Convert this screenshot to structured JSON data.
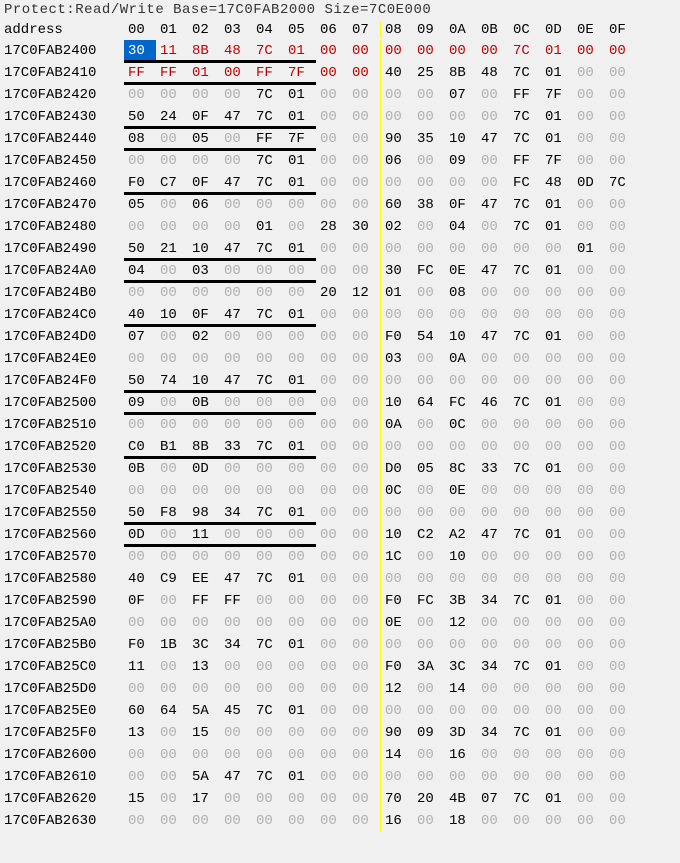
{
  "title_line": "Protect:Read/Write  Base=17C0FAB2000 Size=7C0E000",
  "header": {
    "address_label": "address",
    "cols": [
      "00",
      "01",
      "02",
      "03",
      "04",
      "05",
      "06",
      "07",
      "08",
      "09",
      "0A",
      "0B",
      "0C",
      "0D",
      "0E",
      "0F"
    ]
  },
  "selected": {
    "row": 0,
    "col": 0
  },
  "red_cells": [
    {
      "row": 0,
      "start": 0,
      "end": 7
    },
    {
      "row": 0,
      "start": 8,
      "end": 15
    },
    {
      "row": 1,
      "start": 0,
      "end": 7
    }
  ],
  "underlines": [
    {
      "row": 0,
      "cols": 6
    },
    {
      "row": 1,
      "cols": 6
    },
    {
      "row": 3,
      "cols": 6
    },
    {
      "row": 4,
      "cols": 6
    },
    {
      "row": 6,
      "cols": 6
    },
    {
      "row": 9,
      "cols": 6
    },
    {
      "row": 10,
      "cols": 6
    },
    {
      "row": 12,
      "cols": 6
    },
    {
      "row": 15,
      "cols": 6
    },
    {
      "row": 16,
      "cols": 6
    },
    {
      "row": 18,
      "cols": 6
    },
    {
      "row": 21,
      "cols": 6
    },
    {
      "row": 22,
      "cols": 6
    }
  ],
  "rows": [
    {
      "addr": "17C0FAB2400",
      "b": [
        "30",
        "11",
        "8B",
        "48",
        "7C",
        "01",
        "00",
        "00",
        "00",
        "00",
        "00",
        "00",
        "7C",
        "01",
        "00",
        "00"
      ]
    },
    {
      "addr": "17C0FAB2410",
      "b": [
        "FF",
        "FF",
        "01",
        "00",
        "FF",
        "7F",
        "00",
        "00",
        "40",
        "25",
        "8B",
        "48",
        "7C",
        "01",
        "00",
        "00"
      ]
    },
    {
      "addr": "17C0FAB2420",
      "b": [
        "00",
        "00",
        "00",
        "00",
        "7C",
        "01",
        "00",
        "00",
        "00",
        "00",
        "07",
        "00",
        "FF",
        "7F",
        "00",
        "00"
      ]
    },
    {
      "addr": "17C0FAB2430",
      "b": [
        "50",
        "24",
        "0F",
        "47",
        "7C",
        "01",
        "00",
        "00",
        "00",
        "00",
        "00",
        "00",
        "7C",
        "01",
        "00",
        "00"
      ]
    },
    {
      "addr": "17C0FAB2440",
      "b": [
        "08",
        "00",
        "05",
        "00",
        "FF",
        "7F",
        "00",
        "00",
        "90",
        "35",
        "10",
        "47",
        "7C",
        "01",
        "00",
        "00"
      ]
    },
    {
      "addr": "17C0FAB2450",
      "b": [
        "00",
        "00",
        "00",
        "00",
        "7C",
        "01",
        "00",
        "00",
        "06",
        "00",
        "09",
        "00",
        "FF",
        "7F",
        "00",
        "00"
      ]
    },
    {
      "addr": "17C0FAB2460",
      "b": [
        "F0",
        "C7",
        "0F",
        "47",
        "7C",
        "01",
        "00",
        "00",
        "00",
        "00",
        "00",
        "00",
        "FC",
        "48",
        "0D",
        "7C"
      ]
    },
    {
      "addr": "17C0FAB2470",
      "b": [
        "05",
        "00",
        "06",
        "00",
        "00",
        "00",
        "00",
        "00",
        "60",
        "38",
        "0F",
        "47",
        "7C",
        "01",
        "00",
        "00"
      ]
    },
    {
      "addr": "17C0FAB2480",
      "b": [
        "00",
        "00",
        "00",
        "00",
        "01",
        "00",
        "28",
        "30",
        "02",
        "00",
        "04",
        "00",
        "7C",
        "01",
        "00",
        "00"
      ]
    },
    {
      "addr": "17C0FAB2490",
      "b": [
        "50",
        "21",
        "10",
        "47",
        "7C",
        "01",
        "00",
        "00",
        "00",
        "00",
        "00",
        "00",
        "00",
        "00",
        "01",
        "00"
      ]
    },
    {
      "addr": "17C0FAB24A0",
      "b": [
        "04",
        "00",
        "03",
        "00",
        "00",
        "00",
        "00",
        "00",
        "30",
        "FC",
        "0E",
        "47",
        "7C",
        "01",
        "00",
        "00"
      ]
    },
    {
      "addr": "17C0FAB24B0",
      "b": [
        "00",
        "00",
        "00",
        "00",
        "00",
        "00",
        "20",
        "12",
        "01",
        "00",
        "08",
        "00",
        "00",
        "00",
        "00",
        "00"
      ]
    },
    {
      "addr": "17C0FAB24C0",
      "b": [
        "40",
        "10",
        "0F",
        "47",
        "7C",
        "01",
        "00",
        "00",
        "00",
        "00",
        "00",
        "00",
        "00",
        "00",
        "00",
        "00"
      ]
    },
    {
      "addr": "17C0FAB24D0",
      "b": [
        "07",
        "00",
        "02",
        "00",
        "00",
        "00",
        "00",
        "00",
        "F0",
        "54",
        "10",
        "47",
        "7C",
        "01",
        "00",
        "00"
      ]
    },
    {
      "addr": "17C0FAB24E0",
      "b": [
        "00",
        "00",
        "00",
        "00",
        "00",
        "00",
        "00",
        "00",
        "03",
        "00",
        "0A",
        "00",
        "00",
        "00",
        "00",
        "00"
      ]
    },
    {
      "addr": "17C0FAB24F0",
      "b": [
        "50",
        "74",
        "10",
        "47",
        "7C",
        "01",
        "00",
        "00",
        "00",
        "00",
        "00",
        "00",
        "00",
        "00",
        "00",
        "00"
      ]
    },
    {
      "addr": "17C0FAB2500",
      "b": [
        "09",
        "00",
        "0B",
        "00",
        "00",
        "00",
        "00",
        "00",
        "10",
        "64",
        "FC",
        "46",
        "7C",
        "01",
        "00",
        "00"
      ]
    },
    {
      "addr": "17C0FAB2510",
      "b": [
        "00",
        "00",
        "00",
        "00",
        "00",
        "00",
        "00",
        "00",
        "0A",
        "00",
        "0C",
        "00",
        "00",
        "00",
        "00",
        "00"
      ]
    },
    {
      "addr": "17C0FAB2520",
      "b": [
        "C0",
        "B1",
        "8B",
        "33",
        "7C",
        "01",
        "00",
        "00",
        "00",
        "00",
        "00",
        "00",
        "00",
        "00",
        "00",
        "00"
      ]
    },
    {
      "addr": "17C0FAB2530",
      "b": [
        "0B",
        "00",
        "0D",
        "00",
        "00",
        "00",
        "00",
        "00",
        "D0",
        "05",
        "8C",
        "33",
        "7C",
        "01",
        "00",
        "00"
      ]
    },
    {
      "addr": "17C0FAB2540",
      "b": [
        "00",
        "00",
        "00",
        "00",
        "00",
        "00",
        "00",
        "00",
        "0C",
        "00",
        "0E",
        "00",
        "00",
        "00",
        "00",
        "00"
      ]
    },
    {
      "addr": "17C0FAB2550",
      "b": [
        "50",
        "F8",
        "98",
        "34",
        "7C",
        "01",
        "00",
        "00",
        "00",
        "00",
        "00",
        "00",
        "00",
        "00",
        "00",
        "00"
      ]
    },
    {
      "addr": "17C0FAB2560",
      "b": [
        "0D",
        "00",
        "11",
        "00",
        "00",
        "00",
        "00",
        "00",
        "10",
        "C2",
        "A2",
        "47",
        "7C",
        "01",
        "00",
        "00"
      ]
    },
    {
      "addr": "17C0FAB2570",
      "b": [
        "00",
        "00",
        "00",
        "00",
        "00",
        "00",
        "00",
        "00",
        "1C",
        "00",
        "10",
        "00",
        "00",
        "00",
        "00",
        "00"
      ]
    },
    {
      "addr": "17C0FAB2580",
      "b": [
        "40",
        "C9",
        "EE",
        "47",
        "7C",
        "01",
        "00",
        "00",
        "00",
        "00",
        "00",
        "00",
        "00",
        "00",
        "00",
        "00"
      ]
    },
    {
      "addr": "17C0FAB2590",
      "b": [
        "0F",
        "00",
        "FF",
        "FF",
        "00",
        "00",
        "00",
        "00",
        "F0",
        "FC",
        "3B",
        "34",
        "7C",
        "01",
        "00",
        "00"
      ]
    },
    {
      "addr": "17C0FAB25A0",
      "b": [
        "00",
        "00",
        "00",
        "00",
        "00",
        "00",
        "00",
        "00",
        "0E",
        "00",
        "12",
        "00",
        "00",
        "00",
        "00",
        "00"
      ]
    },
    {
      "addr": "17C0FAB25B0",
      "b": [
        "F0",
        "1B",
        "3C",
        "34",
        "7C",
        "01",
        "00",
        "00",
        "00",
        "00",
        "00",
        "00",
        "00",
        "00",
        "00",
        "00"
      ]
    },
    {
      "addr": "17C0FAB25C0",
      "b": [
        "11",
        "00",
        "13",
        "00",
        "00",
        "00",
        "00",
        "00",
        "F0",
        "3A",
        "3C",
        "34",
        "7C",
        "01",
        "00",
        "00"
      ]
    },
    {
      "addr": "17C0FAB25D0",
      "b": [
        "00",
        "00",
        "00",
        "00",
        "00",
        "00",
        "00",
        "00",
        "12",
        "00",
        "14",
        "00",
        "00",
        "00",
        "00",
        "00"
      ]
    },
    {
      "addr": "17C0FAB25E0",
      "b": [
        "60",
        "64",
        "5A",
        "45",
        "7C",
        "01",
        "00",
        "00",
        "00",
        "00",
        "00",
        "00",
        "00",
        "00",
        "00",
        "00"
      ]
    },
    {
      "addr": "17C0FAB25F0",
      "b": [
        "13",
        "00",
        "15",
        "00",
        "00",
        "00",
        "00",
        "00",
        "90",
        "09",
        "3D",
        "34",
        "7C",
        "01",
        "00",
        "00"
      ]
    },
    {
      "addr": "17C0FAB2600",
      "b": [
        "00",
        "00",
        "00",
        "00",
        "00",
        "00",
        "00",
        "00",
        "14",
        "00",
        "16",
        "00",
        "00",
        "00",
        "00",
        "00"
      ]
    },
    {
      "addr": "17C0FAB2610",
      "b": [
        "00",
        "00",
        "5A",
        "47",
        "7C",
        "01",
        "00",
        "00",
        "00",
        "00",
        "00",
        "00",
        "00",
        "00",
        "00",
        "00"
      ]
    },
    {
      "addr": "17C0FAB2620",
      "b": [
        "15",
        "00",
        "17",
        "00",
        "00",
        "00",
        "00",
        "00",
        "70",
        "20",
        "4B",
        "07",
        "7C",
        "01",
        "00",
        "00"
      ]
    },
    {
      "addr": "17C0FAB2630",
      "b": [
        "00",
        "00",
        "00",
        "00",
        "00",
        "00",
        "00",
        "00",
        "16",
        "00",
        "18",
        "00",
        "00",
        "00",
        "00",
        "00"
      ]
    }
  ]
}
